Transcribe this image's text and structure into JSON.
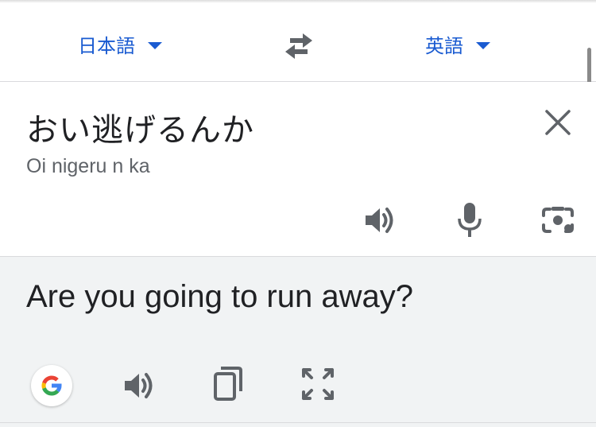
{
  "languages": {
    "source": "日本語",
    "target": "英語"
  },
  "source": {
    "text": "おい逃げるんか",
    "romanization": "Oi nigeru n ka"
  },
  "translation": {
    "text": "Are you going to run away?"
  },
  "icons": {
    "swap": "swap-arrows-icon",
    "clear": "close-icon",
    "speaker": "speaker-icon",
    "mic": "microphone-icon",
    "camera": "camera-icon",
    "google": "google-logo",
    "copy": "copy-icon",
    "expand": "fullscreen-icon"
  },
  "colors": {
    "accent": "#1a5bd1",
    "icon": "#5f6368",
    "output_bg": "#f1f3f4"
  }
}
